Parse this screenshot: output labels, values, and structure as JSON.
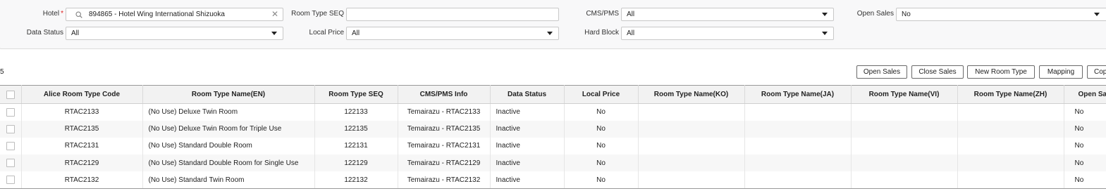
{
  "filters": {
    "hotel": {
      "label": "Hotel",
      "required_mark": "*",
      "value": "894865 - Hotel Wing International Shizuoka",
      "clear": "✕"
    },
    "room_type_seq": {
      "label": "Room Type SEQ",
      "value": ""
    },
    "cms_pms": {
      "label": "CMS/PMS",
      "value": "All"
    },
    "open_sales": {
      "label": "Open Sales",
      "value": "No"
    },
    "data_status": {
      "label": "Data Status",
      "value": "All"
    },
    "local_price": {
      "label": "Local Price",
      "value": "All"
    },
    "hard_block": {
      "label": "Hard Block",
      "value": "All"
    }
  },
  "result_count": "5",
  "actions": {
    "open_sales": "Open Sales",
    "close_sales": "Close Sales",
    "new_room_type": "New Room Type",
    "mapping": "Mapping",
    "copy": "Cop"
  },
  "table": {
    "columns": [
      "Alice Room Type Code",
      "Room Type Name(EN)",
      "Room Type SEQ",
      "CMS/PMS Info",
      "Data Status",
      "Local Price",
      "Room Type Name(KO)",
      "Room Type Name(JA)",
      "Room Type Name(VI)",
      "Room Type Name(ZH)",
      "Open Sa"
    ],
    "rows": [
      {
        "code": "RTAC2133",
        "name_en": "(No Use) Deluxe Twin Room",
        "seq": "122133",
        "cms": "Temairazu - RTAC2133",
        "status": "Inactive",
        "local_price": "No",
        "open_sales": "No"
      },
      {
        "code": "RTAC2135",
        "name_en": "(No Use) Deluxe Twin Room for Triple Use",
        "seq": "122135",
        "cms": "Temairazu - RTAC2135",
        "status": "Inactive",
        "local_price": "No",
        "open_sales": "No"
      },
      {
        "code": "RTAC2131",
        "name_en": "(No Use) Standard Double Room",
        "seq": "122131",
        "cms": "Temairazu - RTAC2131",
        "status": "Inactive",
        "local_price": "No",
        "open_sales": "No"
      },
      {
        "code": "RTAC2129",
        "name_en": "(No Use) Standard Double Room for Single Use",
        "seq": "122129",
        "cms": "Temairazu - RTAC2129",
        "status": "Inactive",
        "local_price": "No",
        "open_sales": "No"
      },
      {
        "code": "RTAC2132",
        "name_en": "(No Use) Standard Twin Room",
        "seq": "122132",
        "cms": "Temairazu - RTAC2132",
        "status": "Inactive",
        "local_price": "No",
        "open_sales": "No"
      }
    ]
  }
}
